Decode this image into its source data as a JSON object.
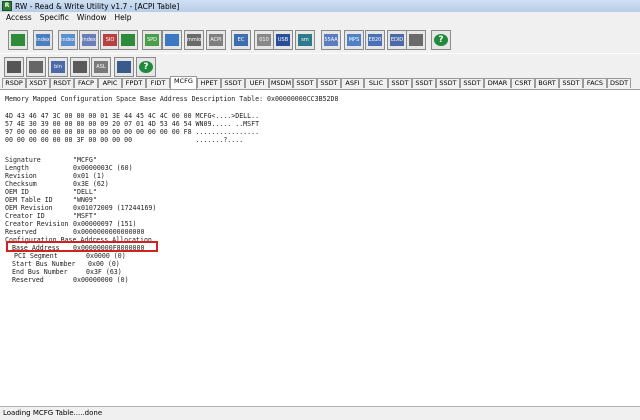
{
  "window": {
    "title": "RW - Read & Write Utility v1.7 - [ACPI Table]"
  },
  "menu": [
    "Access",
    "Specific",
    "Window",
    "Help"
  ],
  "toolbar1": [
    {
      "icon": "pci-board-icon",
      "label": ""
    },
    {
      "icon": "index-data-icon",
      "label": "index"
    },
    {
      "icon": "index-data-icon",
      "label": "index"
    },
    {
      "icon": "pci-data-icon",
      "label": "index"
    },
    {
      "icon": "io-icon",
      "label": "SIO"
    },
    {
      "icon": "scope-icon",
      "label": ""
    },
    {
      "icon": "spd-icon",
      "label": "SPD"
    },
    {
      "icon": "memory-icon",
      "label": ""
    },
    {
      "icon": "mmio-icon",
      "label": "mmio"
    },
    {
      "icon": "acpi-icon",
      "label": "ACPI"
    },
    {
      "icon": "ec-icon",
      "label": "EC"
    },
    {
      "icon": "binary-icon",
      "label": "010"
    },
    {
      "icon": "usb-icon",
      "label": "USB"
    },
    {
      "icon": "smbios-icon",
      "label": "sm bios"
    },
    {
      "icon": "55aa-icon",
      "label": "55AA"
    },
    {
      "icon": "mps-icon",
      "label": "MPS"
    },
    {
      "icon": "e820-icon",
      "label": "E820"
    },
    {
      "icon": "edid-icon",
      "label": "EDID"
    },
    {
      "icon": "cpu-icon",
      "label": ""
    },
    {
      "icon": "help-icon",
      "label": ""
    }
  ],
  "toolbar2": [
    {
      "icon": "save-icon",
      "label": ""
    },
    {
      "icon": "save-all-icon",
      "label": ""
    },
    {
      "icon": "bin-icon",
      "label": "bin"
    },
    {
      "icon": "edit-icon",
      "label": ""
    },
    {
      "icon": "asl-icon",
      "label": "ASL"
    },
    {
      "icon": "find-icon",
      "label": ""
    },
    {
      "icon": "help-icon",
      "label": ""
    }
  ],
  "tabs": [
    "RSDP",
    "XSDT",
    "RSDT",
    "FACP",
    "APIC",
    "FPDT",
    "FIDT",
    "MCFG",
    "HPET",
    "SSDT",
    "UEFI",
    "MSDM",
    "SSDT",
    "SSDT",
    "ASFI",
    "SLIC",
    "SSDT",
    "SSDT",
    "SSDT",
    "SSDT",
    "DMAR",
    "CSRT",
    "BGRT",
    "SSDT",
    "FACS",
    "DSDT"
  ],
  "active_tab": "MCFG",
  "content": {
    "header": "Memory Mapped Configuration Space Base Address Description Table: 0x00000000CC3B52D8",
    "hex": [
      "4D 43 46 47 3C 00 00 00 01 3E 44 45 4C 4C 00 00 MCFG<....>DELL..",
      "57 4E 30 39 00 00 00 00 09 20 07 01 4D 53 46 54 WN09..... ..MSFT",
      "97 00 00 00 00 00 00 00 00 00 00 00 00 00 00 F8 ................",
      "00 00 00 00 00 00 3F 00 00 00 00                .......?...."
    ],
    "fields": [
      {
        "label": "Signature",
        "value": "\"MCFG\""
      },
      {
        "label": "Length",
        "value": "0x0000003C (60)"
      },
      {
        "label": "Revision",
        "value": "0x01 (1)"
      },
      {
        "label": "Checksum",
        "value": "0x3E (62)"
      },
      {
        "label": "OEM ID",
        "value": "\"DELL\""
      },
      {
        "label": "OEM Table ID",
        "value": "\"WN09\""
      },
      {
        "label": "OEM Revision",
        "value": "0x01072009 (17244169)"
      },
      {
        "label": "Creator ID",
        "value": "\"MSFT\""
      },
      {
        "label": "Creator Revision",
        "value": "0x00000097 (151)"
      },
      {
        "label": "Reserved",
        "value": "0x0000000000000000"
      }
    ],
    "alloc_title": "Configuration Base Address Allocation",
    "alloc": [
      {
        "label": "Base Address",
        "value": "0x00000000F8000000"
      },
      {
        "label": "PCI Segment",
        "value": "0x0000 (0)"
      },
      {
        "label": "Start Bus Number",
        "value": "0x00 (0)"
      },
      {
        "label": "End Bus Number",
        "value": "0x3F (63)"
      },
      {
        "label": "Reserved",
        "value": "0x00000000 (0)"
      }
    ]
  },
  "status": "Loading MCFG Table.....done",
  "colors": {
    "highlight": "#d32020",
    "chrome": "#f0f0f0",
    "title": "#b7cde8"
  }
}
